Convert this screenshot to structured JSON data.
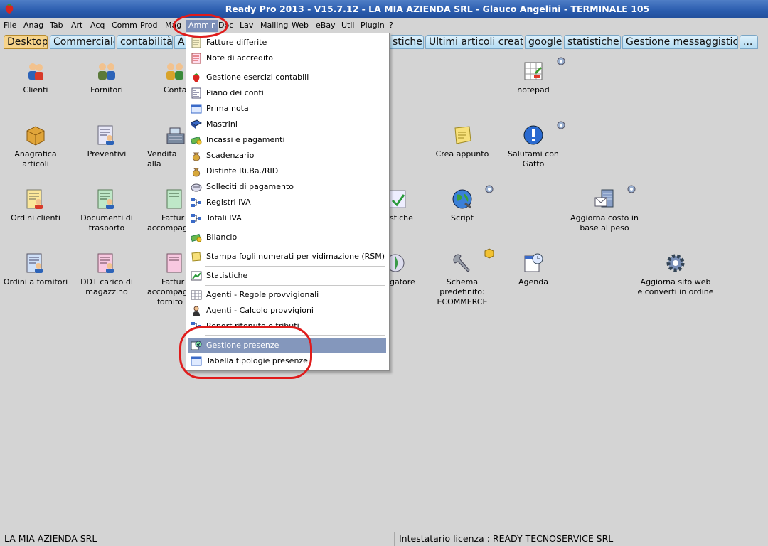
{
  "window": {
    "title": "Ready Pro 2013 - V15.7.12 - LA MIA AZIENDA SRL - Glauco Angelini - TERMINALE 105"
  },
  "menubar": [
    "File",
    "Anag",
    "Tab",
    "Art",
    "Acq",
    "Comm",
    "Prod",
    "Mag",
    "Ammin",
    "Doc",
    "Lav",
    "Mailing",
    "Web",
    "eBay",
    "Util",
    "Plugin",
    "?"
  ],
  "tabs": [
    "Desktop",
    "Commerciale",
    "contabilità",
    "A",
    "stiche",
    "Ultimi articoli creati",
    "google",
    "statistiche",
    "Gestione messaggistica",
    "..."
  ],
  "desktop": {
    "clienti": "Clienti",
    "fornitori": "Fornitori",
    "contatti": "Conta",
    "notepad": "notepad",
    "anagrafica": "Anagrafica articoli",
    "preventivi": "Preventivi",
    "vendita": "Vendita alla",
    "crea_appunto": "Crea appunto",
    "salutami_1": "Salutami con",
    "salutami_2": "Gatto",
    "ordini_clienti": "Ordini clienti",
    "documenti_1": "Documenti di",
    "documenti_2": "trasporto",
    "fatture_1": "Fattur",
    "fatture_2": "accompagn",
    "statistiche": "stiche",
    "script": "Script",
    "aggiorna_costo_1": "Aggiorna costo in",
    "aggiorna_costo_2": "base al peso",
    "ordini_fornitori": "Ordini a fornitori",
    "ddt_1": "DDT carico di",
    "ddt_2": "magazzino",
    "fatture_forn_1": "Fattur",
    "fatture_forn_2": "accompagn",
    "fatture_forn_3": "fornito",
    "navigatore": "gatore",
    "schema_1": "Schema",
    "schema_2": "predefinito:",
    "schema_3": "ECOMMERCE",
    "agenda": "Agenda",
    "aggiorna_sito_1": "Aggiorna sito web",
    "aggiorna_sito_2": "e converti in ordine"
  },
  "ammin_menu": [
    "Fatture differite",
    "Note di accredito",
    "Gestione esercizi contabili",
    "Piano dei conti",
    "Prima nota",
    "Mastrini",
    "Incassi e pagamenti",
    "Scadenzario",
    "Distinte Ri.Ba./RID",
    "Solleciti di pagamento",
    "Registri IVA",
    "Totali IVA",
    "Bilancio",
    "Stampa fogli numerati per vidimazione (RSM)",
    "Statistiche",
    "Agenti - Regole provvigionali",
    "Agenti - Calcolo provvigioni",
    "Report ritenute e tributi",
    "Gestione presenze",
    "Tabella tipologie presenze"
  ],
  "status": {
    "company": "LA MIA AZIENDA SRL",
    "license": "Intestatario licenza : READY TECNOSERVICE SRL"
  },
  "colors": {
    "title_bar": "#2a5cae",
    "menu_highlight": "#8497bc",
    "annotation": "#e01b1b",
    "active_tab": "#f7d48a"
  }
}
